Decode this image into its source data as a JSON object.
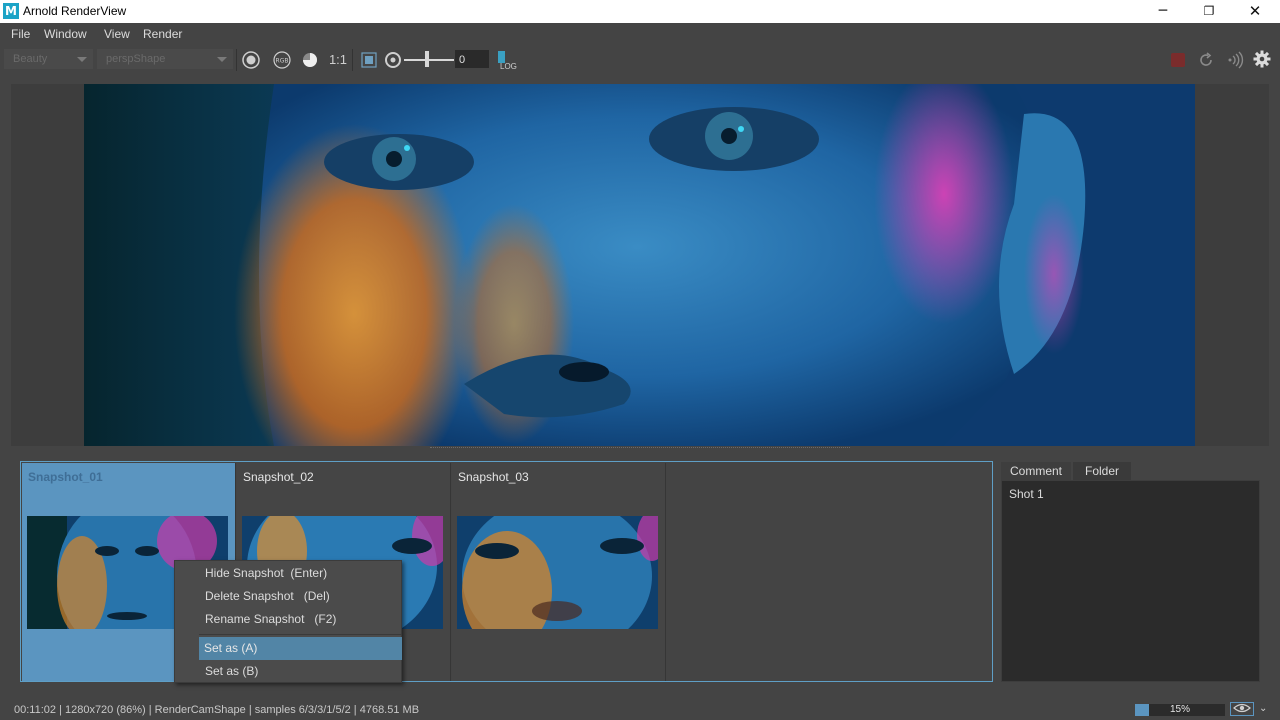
{
  "window": {
    "app_icon": "M",
    "title": "Arnold RenderView",
    "minimize": "─",
    "maximize": "❐",
    "close": "✕"
  },
  "menubar": {
    "items": [
      "File",
      "Window",
      "View",
      "Render"
    ]
  },
  "toolbar": {
    "aov_combo": "Beauty",
    "camera_combo": "perspShape",
    "ratio_label": "1:1",
    "exposure_value": "0",
    "log_label": "LOG",
    "icons": [
      "circle-target-icon",
      "rgb-channel-icon",
      "contrast-icon",
      "frame-icon",
      "aperture-icon",
      "stop-icon",
      "refresh-icon",
      "ipr-icon",
      "gear-icon"
    ]
  },
  "snapshots": [
    {
      "label": "Snapshot_01"
    },
    {
      "label": "Snapshot_02"
    },
    {
      "label": "Snapshot_03"
    }
  ],
  "context_menu": {
    "items": [
      "Hide Snapshot  (Enter)",
      "Delete Snapshot   (Del)",
      "Rename Snapshot   (F2)",
      "Set as (A)",
      "Set as (B)"
    ]
  },
  "right_panel": {
    "tabs": [
      "Comment",
      "Folder"
    ],
    "comment_text": "Shot 1"
  },
  "status": {
    "text": "00:11:02 | 1280x720 (86%) | RenderCamShape  | samples 6/3/3/1/5/2 | 4768.51 MB",
    "progress_label": "15%",
    "progress_fraction": 0.15
  },
  "colors": {
    "accent": "#5b95c0",
    "background": "#444444",
    "stop_red": "#7a2c2c"
  }
}
